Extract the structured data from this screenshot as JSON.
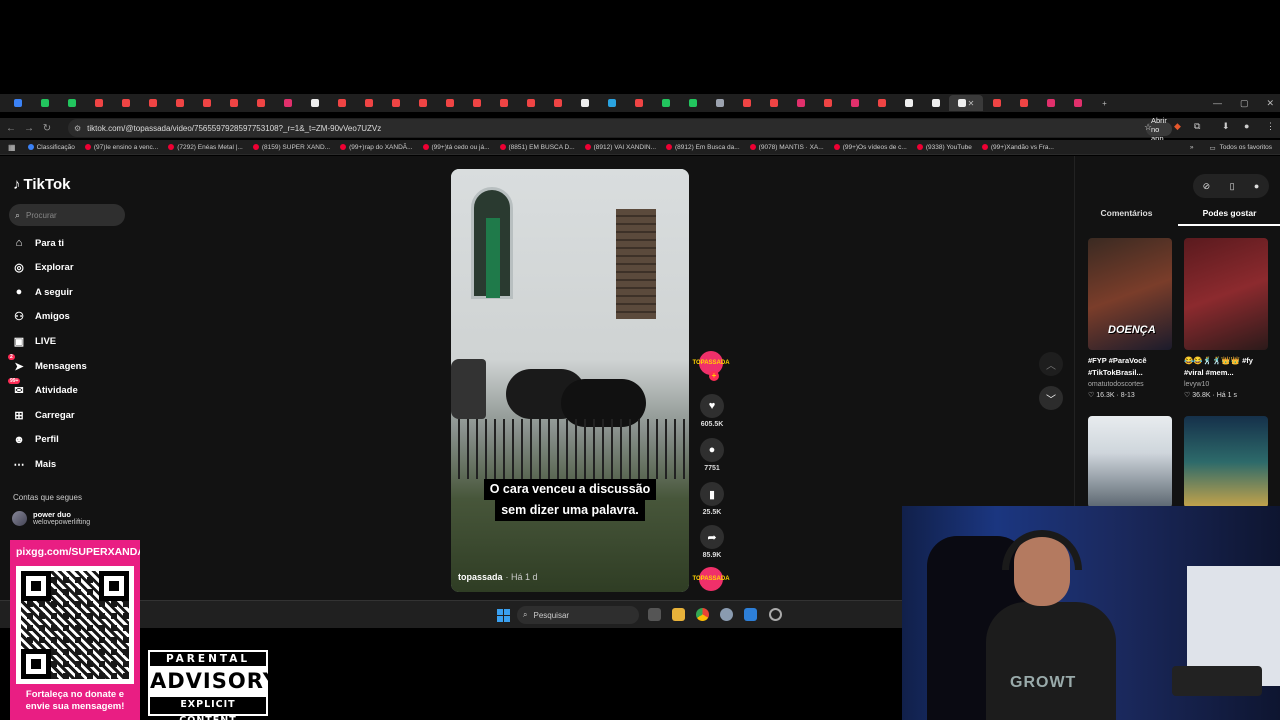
{
  "browser": {
    "url": "tiktok.com/@topassada/video/7565597928597753108?_r=1&_t=ZM-90vVeo7UZVz",
    "open_app_label": "Abrir no app",
    "all_favorites_label": "Todos os favoritos",
    "bookmarks": [
      "Classificação",
      "(97)Ie ensino a venc...",
      "(7292) Enéas Metal |...",
      "(8159) SUPER XAND...",
      "(99+)rap do XANDÃ...",
      "(99+)tá cedo ou já...",
      "(8851) EM BUSCA D...",
      "(8912) VAI XANDIN...",
      "(8912) Em Busca da...",
      "(9078) MANTIS · XA...",
      "(99+)Os vídeos de c...",
      "(9338) YouTube",
      "(99+)Xandão vs Fra..."
    ]
  },
  "sidebar": {
    "logo": "TikTok",
    "search_placeholder": "Procurar",
    "items": [
      {
        "label": "Para ti",
        "icon": "home-icon"
      },
      {
        "label": "Explorar",
        "icon": "compass-icon"
      },
      {
        "label": "A seguir",
        "icon": "avatar-icon"
      },
      {
        "label": "Amigos",
        "icon": "friends-icon"
      },
      {
        "label": "LIVE",
        "icon": "live-icon"
      },
      {
        "label": "Mensagens",
        "icon": "send-icon",
        "badge": "2"
      },
      {
        "label": "Atividade",
        "icon": "inbox-icon",
        "badge": "99+"
      },
      {
        "label": "Carregar",
        "icon": "upload-icon"
      },
      {
        "label": "Perfil",
        "icon": "profile-icon"
      },
      {
        "label": "Mais",
        "icon": "more-icon"
      }
    ],
    "following_title": "Contas que segues",
    "following": [
      {
        "name": "power duo",
        "handle": "welovepowerlifting"
      }
    ]
  },
  "video": {
    "caption_line1": "O cara venceu a discussão",
    "caption_line2": "sem dizer uma palavra.",
    "author": "topassada",
    "posted": "· Há 1 d",
    "likes": "605.5K",
    "comments": "7751",
    "saves": "25.5K",
    "shares": "85.9K"
  },
  "right_panel": {
    "tab_comments": "Comentários",
    "tab_likes": "Podes gostar",
    "cards": [
      {
        "title": "#FYP #ParaVocê #TikTokBrasil...",
        "user": "omatutodoscortes",
        "meta": "♡ 16.3K · 8-13",
        "overlay": "DOENÇA"
      },
      {
        "title": "😂😂🕺🕺👑👑 #fy #viral #mem...",
        "user": "levyw10",
        "meta": "♡ 36.8K · Há 1 s",
        "overlay": ""
      }
    ]
  },
  "taskbar": {
    "search_placeholder": "Pesquisar"
  },
  "overlay": {
    "donate_url": "pixgg.com/SUPERXANDA",
    "donate_message": "Fortaleça no donate e envie sua mensagem!",
    "advisory_line1": "PARENTAL",
    "advisory_line2": "ADVISORY",
    "advisory_line3": "EXPLICIT CONTENT",
    "webcam_shirt": "GROWT"
  },
  "colors": {
    "accent": "#fe2c55",
    "donate_bg": "#e91e83",
    "page_bg": "#121212"
  }
}
